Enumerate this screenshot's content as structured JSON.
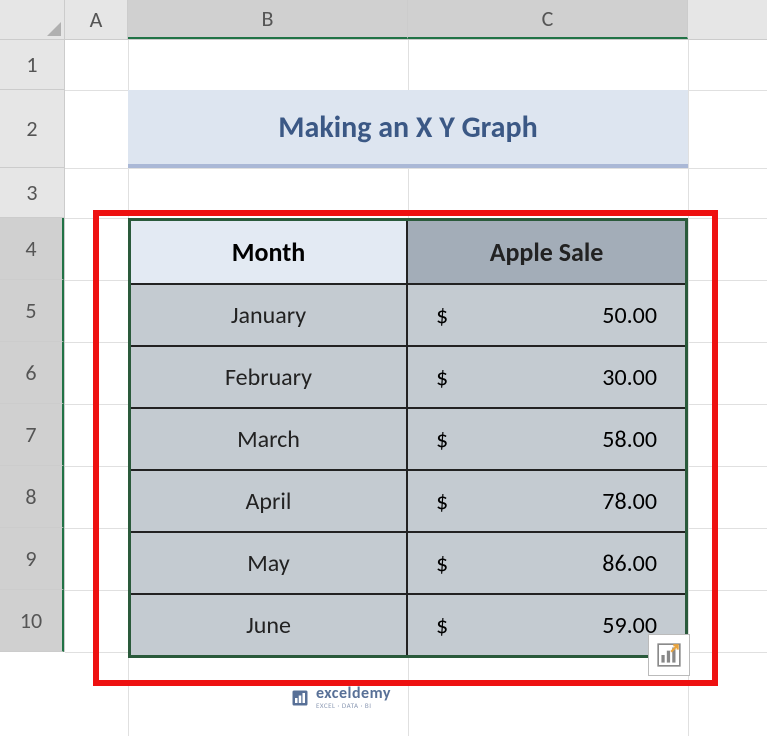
{
  "columns": {
    "a": "A",
    "b": "B",
    "c": "C"
  },
  "rows": {
    "r1": "1",
    "r2": "2",
    "r3": "3",
    "r4": "4",
    "r5": "5",
    "r6": "6",
    "r7": "7",
    "r8": "8",
    "r9": "9",
    "r10": "10"
  },
  "title": "Making an X Y Graph",
  "headers": {
    "month": "Month",
    "sale": "Apple Sale"
  },
  "rows_data": [
    {
      "month": "January",
      "sym": "$",
      "val": "50.00"
    },
    {
      "month": "February",
      "sym": "$",
      "val": "30.00"
    },
    {
      "month": "March",
      "sym": "$",
      "val": "58.00"
    },
    {
      "month": "April",
      "sym": "$",
      "val": "78.00"
    },
    {
      "month": "May",
      "sym": "$",
      "val": "86.00"
    },
    {
      "month": "June",
      "sym": "$",
      "val": "59.00"
    }
  ],
  "watermark": {
    "main": "exceldemy",
    "sub": "EXCEL · DATA · BI"
  },
  "chart_data": {
    "type": "table",
    "title": "Making an X Y Graph",
    "columns": [
      "Month",
      "Apple Sale"
    ],
    "rows": [
      [
        "January",
        50.0
      ],
      [
        "February",
        30.0
      ],
      [
        "March",
        58.0
      ],
      [
        "April",
        78.0
      ],
      [
        "May",
        86.0
      ],
      [
        "June",
        59.0
      ]
    ],
    "currency": "$"
  }
}
